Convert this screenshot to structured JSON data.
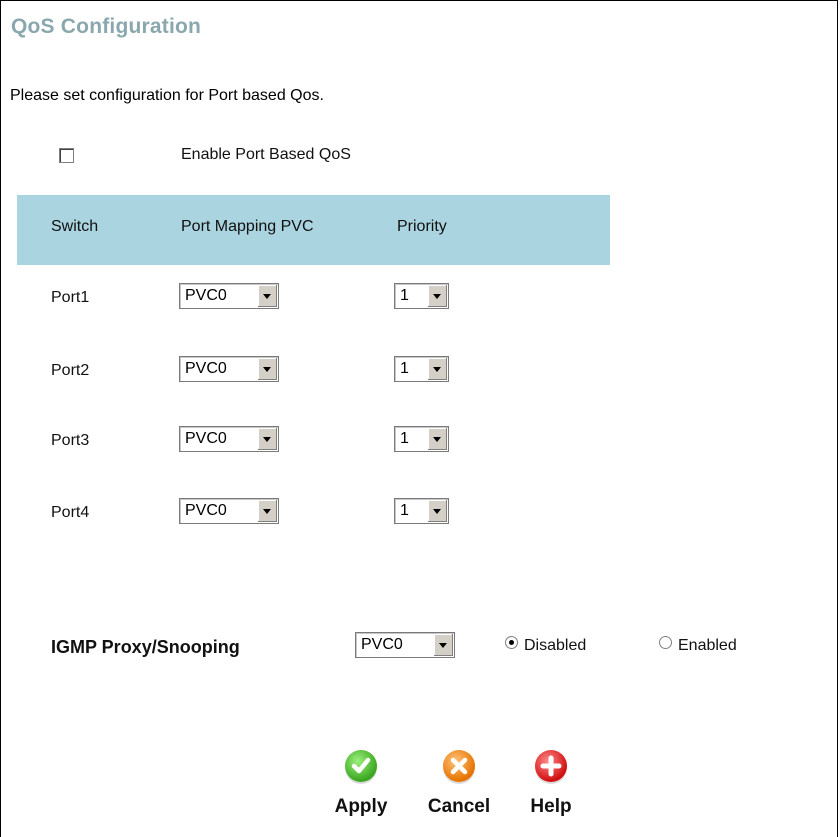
{
  "page": {
    "title": "QoS Configuration",
    "description": "Please set configuration for Port based Qos."
  },
  "enable_port_qos": {
    "label": "Enable Port Based QoS",
    "checked": false
  },
  "table": {
    "headers": [
      "Switch",
      "Port Mapping PVC",
      "Priority"
    ],
    "header_bg": "#a9d4e0",
    "rows": [
      {
        "port": "Port1",
        "pvc": "PVC0",
        "priority": "1"
      },
      {
        "port": "Port2",
        "pvc": "PVC0",
        "priority": "1"
      },
      {
        "port": "Port3",
        "pvc": "PVC0",
        "priority": "1"
      },
      {
        "port": "Port4",
        "pvc": "PVC0",
        "priority": "1"
      }
    ]
  },
  "igmp": {
    "label": "IGMP Proxy/Snooping",
    "pvc": "PVC0",
    "options": [
      "Disabled",
      "Enabled"
    ],
    "selected": "Disabled"
  },
  "buttons": {
    "apply": "Apply",
    "cancel": "Cancel",
    "help": "Help"
  },
  "colors": {
    "title": "#8aa7ae",
    "apply": "#3aa61f",
    "cancel": "#e67300",
    "help": "#d10f0f"
  }
}
